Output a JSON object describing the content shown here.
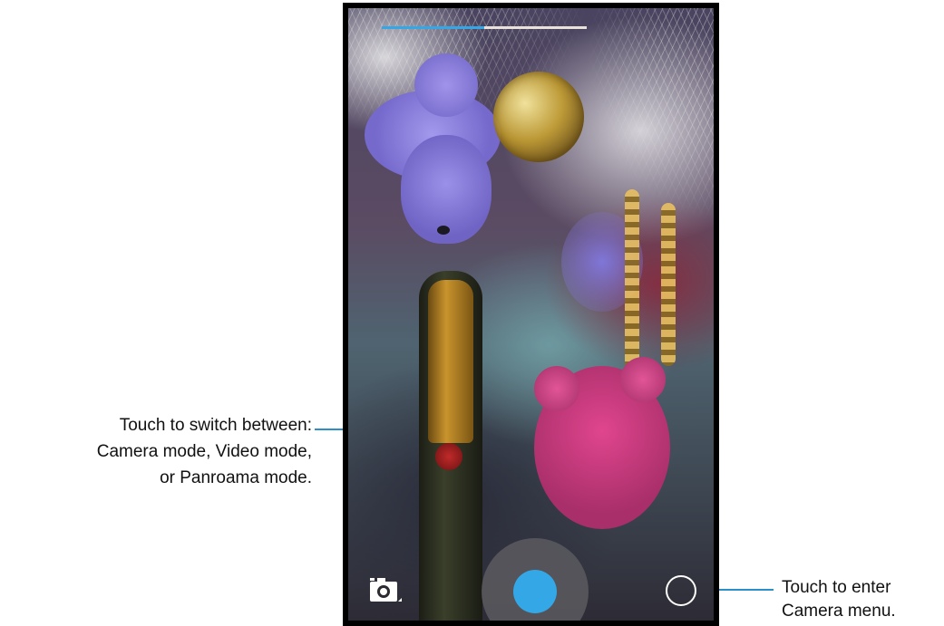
{
  "camera": {
    "progress_fraction": 0.5,
    "icons": {
      "mode_switch": "camera-icon",
      "shutter": "shutter-icon",
      "menu": "circle-menu-icon"
    },
    "colors": {
      "accent": "#34a7e6",
      "progress_track": "#e8e2da",
      "callout_line": "#2c8fc7"
    }
  },
  "callouts": {
    "mode_switch": {
      "line1": "Touch to switch between:",
      "line2": "Camera mode, Video mode,",
      "line3": "or Panroama mode."
    },
    "menu": {
      "line1": "Touch to enter",
      "line2": "Camera menu."
    }
  }
}
